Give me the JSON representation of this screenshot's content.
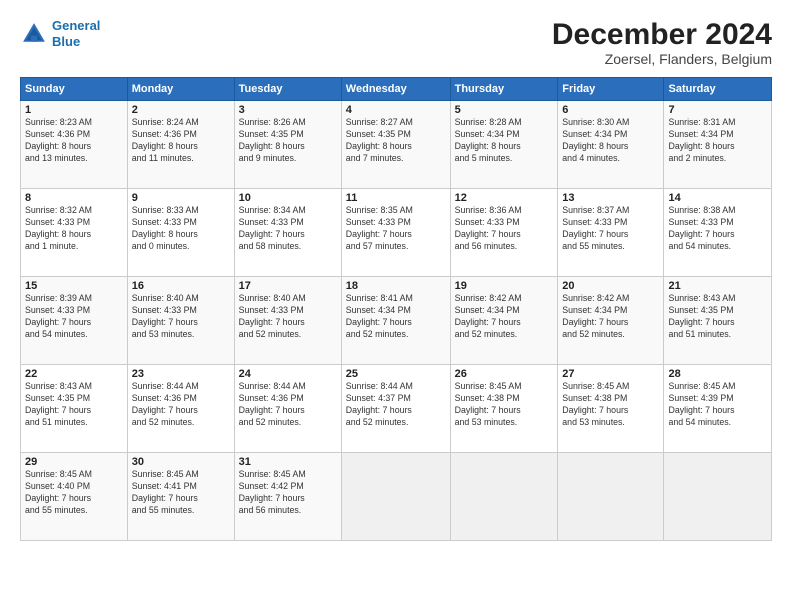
{
  "header": {
    "logo_line1": "General",
    "logo_line2": "Blue",
    "title": "December 2024",
    "subtitle": "Zoersel, Flanders, Belgium"
  },
  "calendar": {
    "headers": [
      "Sunday",
      "Monday",
      "Tuesday",
      "Wednesday",
      "Thursday",
      "Friday",
      "Saturday"
    ],
    "weeks": [
      [
        {
          "num": "",
          "info": ""
        },
        {
          "num": "2",
          "info": "Sunrise: 8:24 AM\nSunset: 4:36 PM\nDaylight: 8 hours\nand 11 minutes."
        },
        {
          "num": "3",
          "info": "Sunrise: 8:26 AM\nSunset: 4:35 PM\nDaylight: 8 hours\nand 9 minutes."
        },
        {
          "num": "4",
          "info": "Sunrise: 8:27 AM\nSunset: 4:35 PM\nDaylight: 8 hours\nand 7 minutes."
        },
        {
          "num": "5",
          "info": "Sunrise: 8:28 AM\nSunset: 4:34 PM\nDaylight: 8 hours\nand 5 minutes."
        },
        {
          "num": "6",
          "info": "Sunrise: 8:30 AM\nSunset: 4:34 PM\nDaylight: 8 hours\nand 4 minutes."
        },
        {
          "num": "7",
          "info": "Sunrise: 8:31 AM\nSunset: 4:34 PM\nDaylight: 8 hours\nand 2 minutes."
        }
      ],
      [
        {
          "num": "8",
          "info": "Sunrise: 8:32 AM\nSunset: 4:33 PM\nDaylight: 8 hours\nand 1 minute."
        },
        {
          "num": "9",
          "info": "Sunrise: 8:33 AM\nSunset: 4:33 PM\nDaylight: 8 hours\nand 0 minutes."
        },
        {
          "num": "10",
          "info": "Sunrise: 8:34 AM\nSunset: 4:33 PM\nDaylight: 7 hours\nand 58 minutes."
        },
        {
          "num": "11",
          "info": "Sunrise: 8:35 AM\nSunset: 4:33 PM\nDaylight: 7 hours\nand 57 minutes."
        },
        {
          "num": "12",
          "info": "Sunrise: 8:36 AM\nSunset: 4:33 PM\nDaylight: 7 hours\nand 56 minutes."
        },
        {
          "num": "13",
          "info": "Sunrise: 8:37 AM\nSunset: 4:33 PM\nDaylight: 7 hours\nand 55 minutes."
        },
        {
          "num": "14",
          "info": "Sunrise: 8:38 AM\nSunset: 4:33 PM\nDaylight: 7 hours\nand 54 minutes."
        }
      ],
      [
        {
          "num": "15",
          "info": "Sunrise: 8:39 AM\nSunset: 4:33 PM\nDaylight: 7 hours\nand 54 minutes."
        },
        {
          "num": "16",
          "info": "Sunrise: 8:40 AM\nSunset: 4:33 PM\nDaylight: 7 hours\nand 53 minutes."
        },
        {
          "num": "17",
          "info": "Sunrise: 8:40 AM\nSunset: 4:33 PM\nDaylight: 7 hours\nand 52 minutes."
        },
        {
          "num": "18",
          "info": "Sunrise: 8:41 AM\nSunset: 4:34 PM\nDaylight: 7 hours\nand 52 minutes."
        },
        {
          "num": "19",
          "info": "Sunrise: 8:42 AM\nSunset: 4:34 PM\nDaylight: 7 hours\nand 52 minutes."
        },
        {
          "num": "20",
          "info": "Sunrise: 8:42 AM\nSunset: 4:34 PM\nDaylight: 7 hours\nand 52 minutes."
        },
        {
          "num": "21",
          "info": "Sunrise: 8:43 AM\nSunset: 4:35 PM\nDaylight: 7 hours\nand 51 minutes."
        }
      ],
      [
        {
          "num": "22",
          "info": "Sunrise: 8:43 AM\nSunset: 4:35 PM\nDaylight: 7 hours\nand 51 minutes."
        },
        {
          "num": "23",
          "info": "Sunrise: 8:44 AM\nSunset: 4:36 PM\nDaylight: 7 hours\nand 52 minutes."
        },
        {
          "num": "24",
          "info": "Sunrise: 8:44 AM\nSunset: 4:36 PM\nDaylight: 7 hours\nand 52 minutes."
        },
        {
          "num": "25",
          "info": "Sunrise: 8:44 AM\nSunset: 4:37 PM\nDaylight: 7 hours\nand 52 minutes."
        },
        {
          "num": "26",
          "info": "Sunrise: 8:45 AM\nSunset: 4:38 PM\nDaylight: 7 hours\nand 53 minutes."
        },
        {
          "num": "27",
          "info": "Sunrise: 8:45 AM\nSunset: 4:38 PM\nDaylight: 7 hours\nand 53 minutes."
        },
        {
          "num": "28",
          "info": "Sunrise: 8:45 AM\nSunset: 4:39 PM\nDaylight: 7 hours\nand 54 minutes."
        }
      ],
      [
        {
          "num": "29",
          "info": "Sunrise: 8:45 AM\nSunset: 4:40 PM\nDaylight: 7 hours\nand 55 minutes."
        },
        {
          "num": "30",
          "info": "Sunrise: 8:45 AM\nSunset: 4:41 PM\nDaylight: 7 hours\nand 55 minutes."
        },
        {
          "num": "31",
          "info": "Sunrise: 8:45 AM\nSunset: 4:42 PM\nDaylight: 7 hours\nand 56 minutes."
        },
        {
          "num": "",
          "info": ""
        },
        {
          "num": "",
          "info": ""
        },
        {
          "num": "",
          "info": ""
        },
        {
          "num": "",
          "info": ""
        }
      ]
    ],
    "first_day_offset": 0
  }
}
